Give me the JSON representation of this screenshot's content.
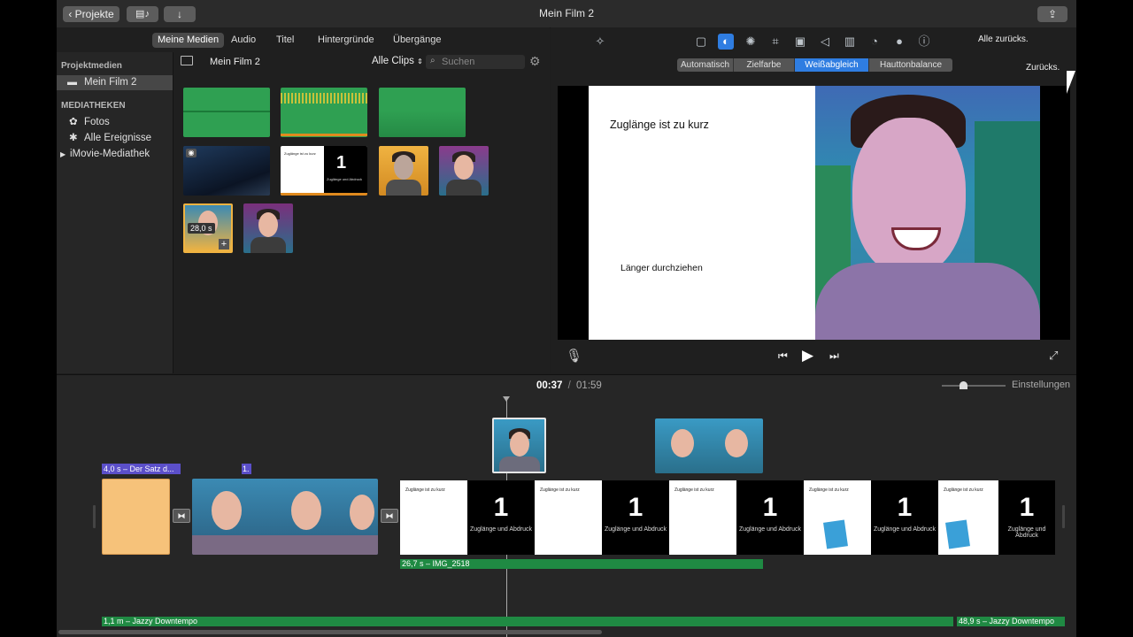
{
  "titlebar": {
    "projects_label": "Projekte",
    "title": "Mein Film 2"
  },
  "tabs": [
    "Meine Medien",
    "Audio",
    "Titel",
    "Hintergründe",
    "Übergänge"
  ],
  "sidebar": {
    "project_media_header": "Projektmedien",
    "project_item": "Mein Film 2",
    "libraries_header": "MEDIATHEKEN",
    "items": [
      "Fotos",
      "Alle Ereignisse",
      "iMovie-Mediathek"
    ]
  },
  "browser": {
    "title": "Mein Film 2",
    "filter": "Alle Clips",
    "search_placeholder": "Suchen",
    "clip_duration": "28,0 s"
  },
  "thumb_slide": {
    "heading": "Zuglänge ist zu kurz",
    "number": "1",
    "subtitle": "Zuglänge und Abdruck"
  },
  "adjust": {
    "reset_all": "Alle zurücks.",
    "reset": "Zurücks.",
    "segments": [
      "Automatisch",
      "Zielfarbe",
      "Weißabgleich",
      "Hauttonbalance"
    ],
    "selected_segment": "Weißabgleich"
  },
  "viewer": {
    "slide_title": "Zuglänge ist zu kurz",
    "slide_text": "Länger durchziehen"
  },
  "timeline": {
    "current_time": "00:37",
    "separator": "/",
    "total_time": "01:59",
    "settings_label": "Einstellungen",
    "title_clip_label": "4,0 s – Der Satz d...",
    "title_clip_label2": "1.",
    "audio_clip_label": "26,7 s – IMG_2518",
    "music1_label": "1,1 m – Jazzy Downtempo",
    "music2_label": "48,9 s – Jazzy Downtempo"
  },
  "colors": {
    "accent": "#2f7de1",
    "audio_green": "#1f8a43",
    "title_purple": "#5b4fc9",
    "window_bg": "#1e1e1e"
  }
}
